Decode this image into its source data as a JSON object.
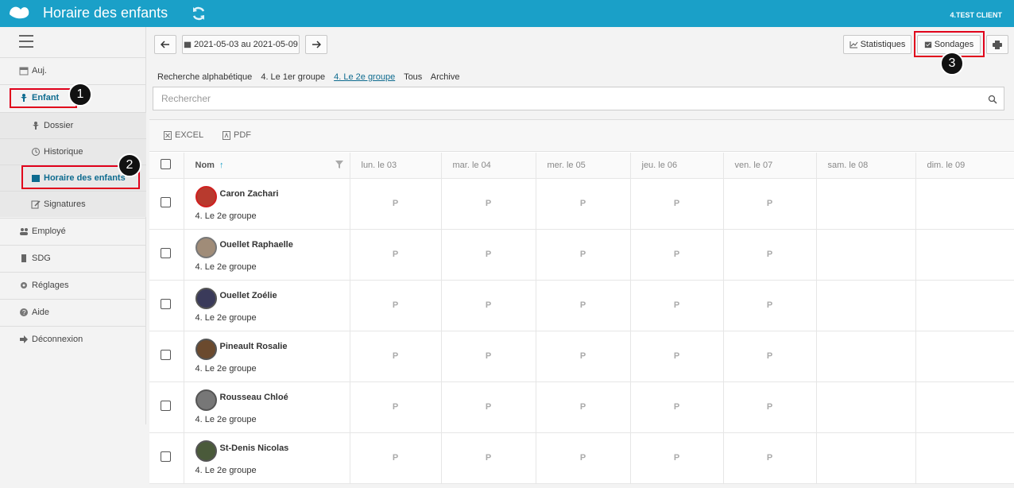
{
  "header": {
    "title": "Horaire des enfants",
    "client": "4.TEST CLIENT",
    "colors": {
      "brand": "#1aa0c8",
      "highlight": "#e0001b"
    }
  },
  "sidebar": {
    "items": [
      {
        "label": "Auj.",
        "icon": "calendar-icon"
      },
      {
        "label": "Enfant",
        "icon": "child-icon"
      },
      {
        "label": "Dossier",
        "icon": "child-icon"
      },
      {
        "label": "Historique",
        "icon": "history-icon"
      },
      {
        "label": "Horaire des enfants",
        "icon": "calendar-icon"
      },
      {
        "label": "Signatures",
        "icon": "edit-icon"
      },
      {
        "label": "Employé",
        "icon": "users-icon"
      },
      {
        "label": "SDG",
        "icon": "building-icon"
      },
      {
        "label": "Réglages",
        "icon": "gear-icon"
      },
      {
        "label": "Aide",
        "icon": "help-icon"
      },
      {
        "label": "Déconnexion",
        "icon": "logout-icon"
      }
    ]
  },
  "annotations": {
    "b1": "1",
    "b2": "2",
    "b3": "3"
  },
  "toolbar": {
    "date_range": "2021-05-03 au 2021-05-09",
    "stats_label": "Statistiques",
    "surveys_label": "Sondages"
  },
  "filters": {
    "items": [
      "Recherche alphabétique",
      "4. Le 1er groupe",
      "4. Le 2e groupe",
      "Tous",
      "Archive"
    ],
    "selected": "4. Le 2e groupe"
  },
  "search": {
    "placeholder": "Rechercher"
  },
  "exports": {
    "excel": "EXCEL",
    "pdf": "PDF"
  },
  "table": {
    "headers": [
      "Nom",
      "lun. le 03",
      "mar. le 04",
      "mer. le 05",
      "jeu. le 06",
      "ven. le 07",
      "sam. le 08",
      "dim. le 09"
    ],
    "sort_indicator": "↑",
    "rows": [
      {
        "name": "Caron Zachari",
        "group": "4. Le 2e groupe",
        "days": [
          "P",
          "P",
          "P",
          "P",
          "P",
          "",
          ""
        ]
      },
      {
        "name": "Ouellet Raphaelle",
        "group": "4. Le 2e groupe",
        "days": [
          "P",
          "P",
          "P",
          "P",
          "P",
          "",
          ""
        ]
      },
      {
        "name": "Ouellet Zoélie",
        "group": "4. Le 2e groupe",
        "days": [
          "P",
          "P",
          "P",
          "P",
          "P",
          "",
          ""
        ]
      },
      {
        "name": "Pineault Rosalie",
        "group": "4. Le 2e groupe",
        "days": [
          "P",
          "P",
          "P",
          "P",
          "P",
          "",
          ""
        ]
      },
      {
        "name": "Rousseau Chloé",
        "group": "4. Le 2e groupe",
        "days": [
          "P",
          "P",
          "P",
          "P",
          "P",
          "",
          ""
        ]
      },
      {
        "name": "St-Denis Nicolas",
        "group": "4. Le 2e groupe",
        "days": [
          "P",
          "P",
          "P",
          "P",
          "P",
          "",
          ""
        ]
      }
    ]
  }
}
